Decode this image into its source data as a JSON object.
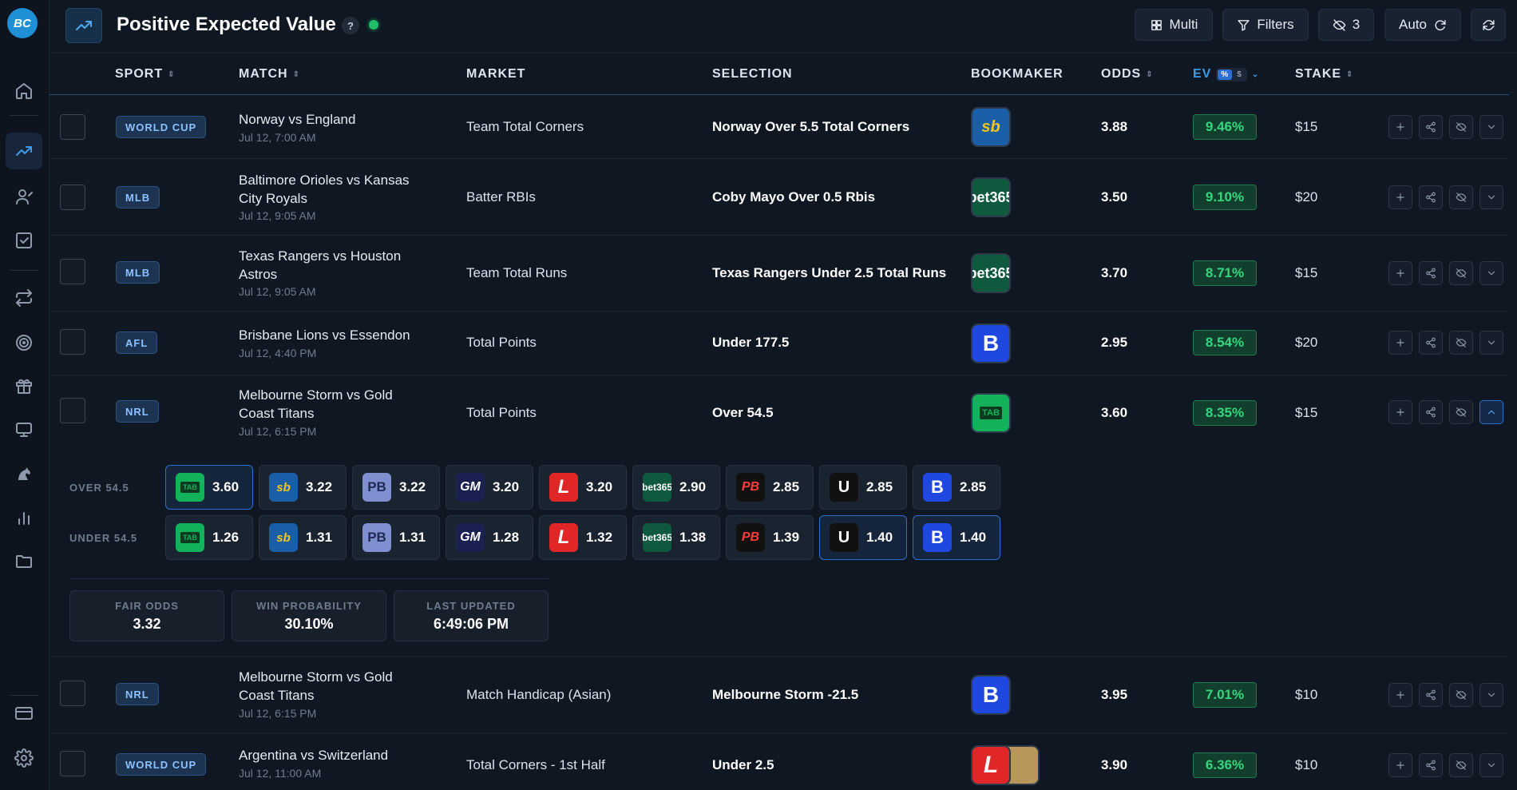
{
  "app": {
    "logo_text": "BC",
    "title": "Positive Expected Value",
    "help": "?"
  },
  "toolbar": {
    "multi": "Multi",
    "filters": "Filters",
    "hidden_count": "3",
    "auto": "Auto"
  },
  "sidebar": {
    "icons": [
      "home-icon",
      "trending-up-icon",
      "user-icon",
      "checklist-icon",
      "repeat-icon",
      "target-icon",
      "gift-icon",
      "monitor-icon",
      "horse-icon",
      "bar-chart-icon",
      "folder-icon",
      "credit-card-icon",
      "gear-icon"
    ]
  },
  "columns": {
    "sport": "SPORT",
    "match": "MATCH",
    "market": "MARKET",
    "selection": "SELECTION",
    "bookmaker": "BOOKMAKER",
    "odds": "ODDS",
    "ev": "EV",
    "ev_pct": "%",
    "ev_dollar": "$",
    "stake": "STAKE"
  },
  "rows": [
    {
      "sport": "WORLD CUP",
      "match": "Norway vs England",
      "time": "Jul 12, 7:00 AM",
      "market": "Team Total Corners",
      "selection": "Norway Over 5.5 Total Corners",
      "bookmaker": "sb",
      "odds": "3.88",
      "ev": "9.46%",
      "stake": "$15"
    },
    {
      "sport": "MLB",
      "match": "Baltimore Orioles vs Kansas City Royals",
      "time": "Jul 12, 9:05 AM",
      "market": "Batter RBIs",
      "selection": "Coby Mayo Over 0.5 Rbis",
      "bookmaker": "bet365",
      "odds": "3.50",
      "ev": "9.10%",
      "stake": "$20"
    },
    {
      "sport": "MLB",
      "match": "Texas Rangers vs Houston Astros",
      "time": "Jul 12, 9:05 AM",
      "market": "Team Total Runs",
      "selection": "Texas Rangers Under 2.5 Total Runs",
      "bookmaker": "bet365",
      "odds": "3.70",
      "ev": "8.71%",
      "stake": "$15"
    },
    {
      "sport": "AFL",
      "match": "Brisbane Lions vs Essendon",
      "time": "Jul 12, 4:40 PM",
      "market": "Total Points",
      "selection": "Under 177.5",
      "bookmaker": "B",
      "odds": "2.95",
      "ev": "8.54%",
      "stake": "$20"
    },
    {
      "sport": "NRL",
      "match": "Melbourne Storm vs Gold Coast Titans",
      "time": "Jul 12, 6:15 PM",
      "market": "Total Points",
      "selection": "Over 54.5",
      "bookmaker": "TAB",
      "odds": "3.60",
      "ev": "8.35%",
      "stake": "$15"
    },
    {
      "sport": "NRL",
      "match": "Melbourne Storm vs Gold Coast Titans",
      "time": "Jul 12, 6:15 PM",
      "market": "Match Handicap (Asian)",
      "selection": "Melbourne Storm -21.5",
      "bookmaker": "B",
      "odds": "3.95",
      "ev": "7.01%",
      "stake": "$10"
    },
    {
      "sport": "WORLD CUP",
      "match": "Argentina vs Switzerland",
      "time": "Jul 12, 11:00 AM",
      "market": "Total Corners - 1st Half",
      "selection": "Under 2.5",
      "bookmaker": "L",
      "odds": "3.90",
      "ev": "6.36%",
      "stake": "$10"
    }
  ],
  "expanded": {
    "over_label": "OVER 54.5",
    "under_label": "UNDER 54.5",
    "bookmakers": [
      "TAB",
      "sb",
      "PB",
      "GM",
      "L",
      "bet365",
      "PB",
      "U",
      "B"
    ],
    "over": [
      "3.60",
      "3.22",
      "3.22",
      "3.20",
      "3.20",
      "2.90",
      "2.85",
      "2.85",
      "2.85"
    ],
    "under": [
      "1.26",
      "1.31",
      "1.31",
      "1.28",
      "1.32",
      "1.38",
      "1.39",
      "1.40",
      "1.40"
    ],
    "fair_odds_label": "FAIR ODDS",
    "fair_odds": "3.32",
    "win_prob_label": "WIN PROBABILITY",
    "win_prob": "30.10%",
    "updated_label": "LAST UPDATED",
    "updated": "6:49:06 PM"
  }
}
